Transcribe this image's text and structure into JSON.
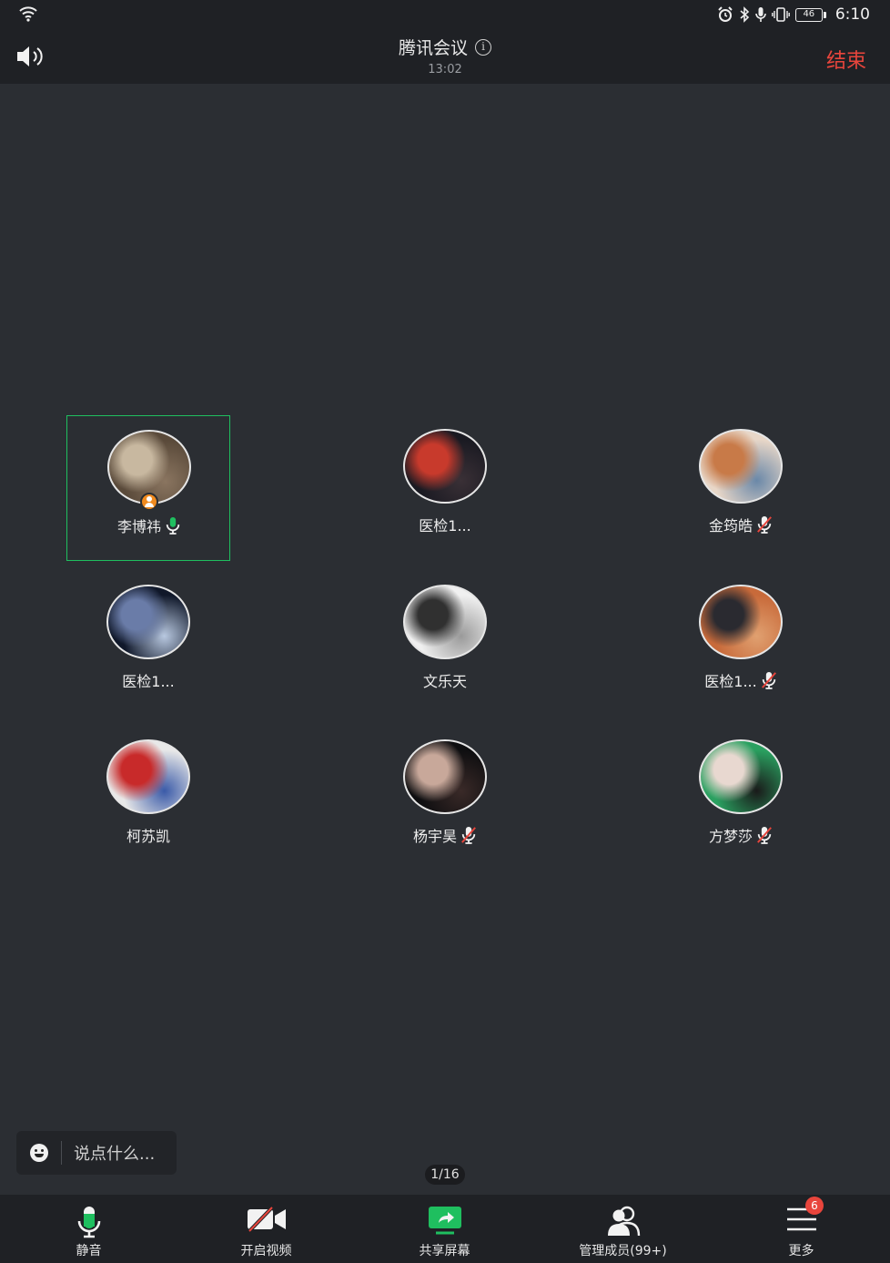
{
  "status_bar": {
    "time": "6:10",
    "battery": "46"
  },
  "header": {
    "title": "腾讯会议",
    "duration": "13:02",
    "end_label": "结束"
  },
  "participants": [
    {
      "name": "李博祎",
      "mic": "on",
      "host": true,
      "speaking": true,
      "avatar_colors": [
        "#5a4a3a",
        "#c8b8a0",
        "#8a7560"
      ]
    },
    {
      "name": "医检1...",
      "mic": "none",
      "host": false,
      "speaking": false,
      "avatar_colors": [
        "#1a1a22",
        "#c83a2c",
        "#3a3036"
      ]
    },
    {
      "name": "金筠皓",
      "mic": "muted",
      "host": false,
      "speaking": false,
      "avatar_colors": [
        "#e8d7c8",
        "#c87a48",
        "#6a88a8"
      ]
    },
    {
      "name": "医检1...",
      "mic": "none",
      "host": false,
      "speaking": false,
      "avatar_colors": [
        "#10182a",
        "#6a7ca8",
        "#b8c8e0"
      ]
    },
    {
      "name": "文乐天",
      "mic": "none",
      "host": false,
      "speaking": false,
      "avatar_colors": [
        "#f0f0f0",
        "#303030",
        "#9a9a9a"
      ]
    },
    {
      "name": "医检1...",
      "mic": "muted",
      "host": false,
      "speaking": false,
      "avatar_colors": [
        "#c86a3a",
        "#2a2a30",
        "#e0a070"
      ]
    },
    {
      "name": "柯苏凯",
      "mic": "none",
      "host": false,
      "speaking": false,
      "avatar_colors": [
        "#e8e8e8",
        "#c82a2a",
        "#3a5aa8"
      ]
    },
    {
      "name": "杨宇昊",
      "mic": "muted",
      "host": false,
      "speaking": false,
      "avatar_colors": [
        "#0e0e10",
        "#c8a89a",
        "#3a2a28"
      ]
    },
    {
      "name": "方梦莎",
      "mic": "muted",
      "host": false,
      "speaking": false,
      "avatar_colors": [
        "#2aa060",
        "#e8d8d0",
        "#1a1a1a"
      ]
    }
  ],
  "chat": {
    "placeholder": "说点什么..."
  },
  "pagination": "1/16",
  "toolbar": {
    "mute_label": "静音",
    "video_label": "开启视频",
    "share_label": "共享屏幕",
    "members_label": "管理成员(99+)",
    "more_label": "更多",
    "more_badge": "6"
  },
  "colors": {
    "accent_green": "#1fbf5f",
    "end_red": "#e8453c",
    "host_orange": "#f08a1e"
  }
}
